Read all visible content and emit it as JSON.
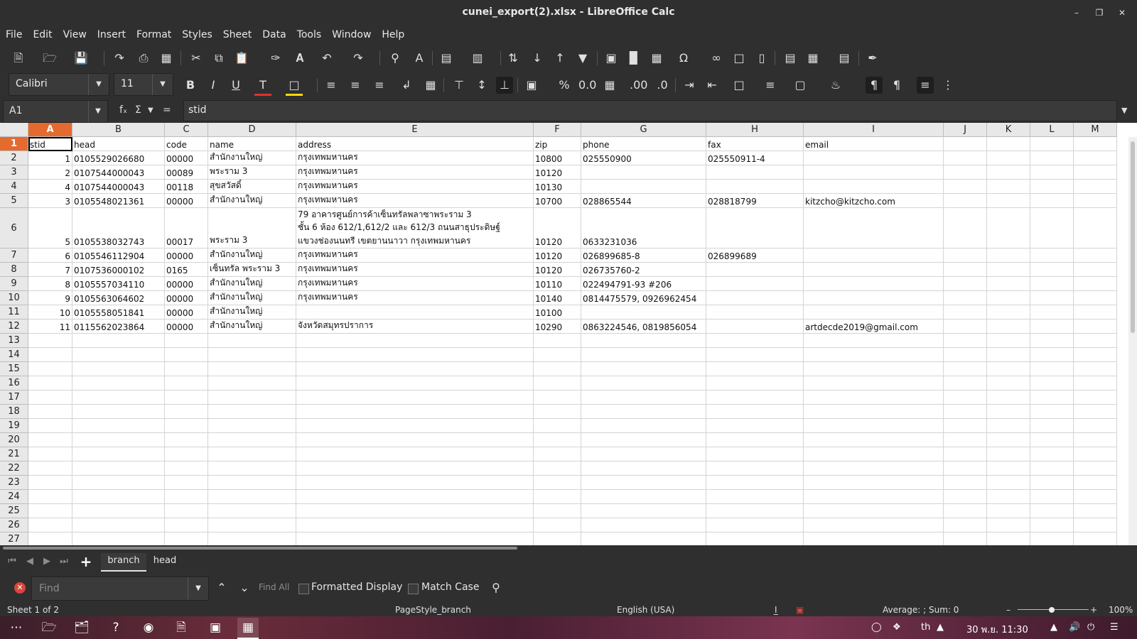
{
  "window": {
    "title": "cunei_export(2).xlsx - LibreOffice Calc"
  },
  "menu": [
    "File",
    "Edit",
    "View",
    "Insert",
    "Format",
    "Styles",
    "Sheet",
    "Data",
    "Tools",
    "Window",
    "Help"
  ],
  "format": {
    "font_name": "Calibri",
    "font_size": "11"
  },
  "formula": {
    "cell_ref": "A1",
    "value": "stid"
  },
  "grid": {
    "columns": [
      "A",
      "B",
      "C",
      "D",
      "E",
      "F",
      "G",
      "H",
      "I",
      "J",
      "K",
      "L",
      "M"
    ],
    "row_numbers": [
      "1",
      "2",
      "3",
      "4",
      "5",
      "6",
      "7",
      "8",
      "9",
      "10",
      "11",
      "12",
      "13",
      "14",
      "15",
      "16",
      "17",
      "18",
      "19",
      "20",
      "21",
      "22",
      "23",
      "24",
      "25",
      "26",
      "27"
    ],
    "rows": [
      [
        "stid",
        "head",
        "code",
        "name",
        "address",
        "zip",
        "phone",
        "fax",
        "email"
      ],
      [
        "1",
        "0105529026680",
        "00000",
        "สำนักงานใหญ่",
        "กรุงเทพมหานคร",
        "10800",
        "025550900",
        "025550911-4",
        ""
      ],
      [
        "2",
        "0107544000043",
        "00089",
        "พระราม 3",
        "กรุงเทพมหานคร",
        "10120",
        "",
        "",
        ""
      ],
      [
        "4",
        "0107544000043",
        "00118",
        "สุขสวัสดิ์",
        "กรุงเทพมหานคร",
        "10130",
        "",
        "",
        ""
      ],
      [
        "3",
        "0105548021361",
        "00000",
        "สำนักงานใหญ่",
        "กรุงเทพมหานคร",
        "10700",
        "028865544",
        "028818799",
        "kitzcho@kitzcho.com"
      ],
      [
        "5",
        "0105538032743",
        "00017",
        "พระราม 3",
        "79 อาคารศูนย์การค้าเซ็นทรัลพลาซาพระราม 3\nชั้น 6 ห้อง 612/1,612/2 และ 612/3 ถนนสาธุประดิษฐ์\nแขวงช่องนนทรี เขตยานนาวา กรุงเทพมหานคร",
        "10120",
        "0633231036",
        "",
        ""
      ],
      [
        "6",
        "0105546112904",
        "00000",
        "สำนักงานใหญ่",
        "กรุงเทพมหานคร",
        "10120",
        "026899685-8",
        "026899689",
        ""
      ],
      [
        "7",
        "0107536000102",
        "0165",
        "เซ็นทรัล พระราม 3",
        "กรุงเทพมหานคร",
        "10120",
        "026735760-2",
        "",
        ""
      ],
      [
        "8",
        "0105557034110",
        "00000",
        "สำนักงานใหญ่",
        "กรุงเทพมหานคร",
        "10110",
        "022494791-93 #206",
        "",
        ""
      ],
      [
        "9",
        "0105563064602",
        "00000",
        "สำนักงานใหญ่",
        "กรุงเทพมหานคร",
        "10140",
        "0814475579, 0926962454",
        "",
        ""
      ],
      [
        "10",
        "0105558051841",
        "00000",
        "สำนักงานใหญ่",
        "",
        "10100",
        "",
        "",
        ""
      ],
      [
        "11",
        "0115562023864",
        "00000",
        "สำนักงานใหญ่",
        "จังหวัดสมุทรปราการ",
        "10290",
        "0863224546, 0819856054",
        "",
        "artdecde2019@gmail.com"
      ]
    ]
  },
  "sheets": [
    {
      "name": "branch",
      "active": true
    },
    {
      "name": "head",
      "active": false
    }
  ],
  "find": {
    "placeholder": "Find",
    "find_all": "Find All",
    "formatted_display": "Formatted Display",
    "match_case": "Match Case"
  },
  "status": {
    "sheet": "Sheet 1 of 2",
    "page_style": "PageStyle_branch",
    "language": "English (USA)",
    "sum": "Average: ; Sum: 0",
    "zoom": "100%"
  },
  "taskbar": {
    "lang": "th",
    "clock": "30 พ.ย.  11:30"
  },
  "colors": {
    "accent": "#e46a2f",
    "chrome": "#2f2f2f"
  }
}
